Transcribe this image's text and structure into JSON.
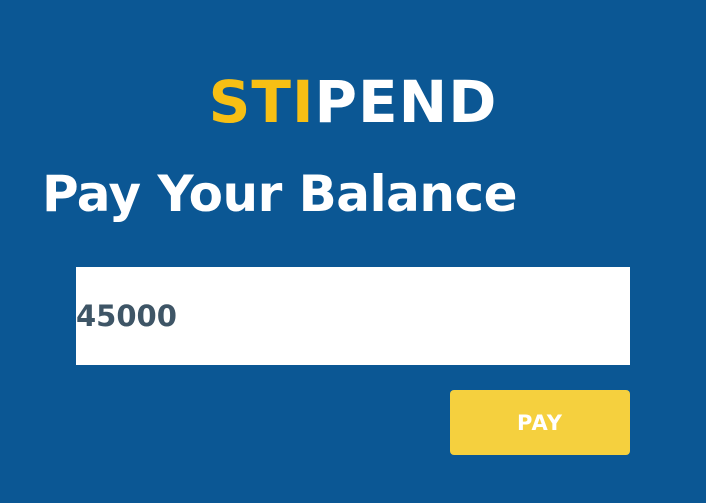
{
  "brand": {
    "accent_text": "STI",
    "rest_text": "PEND",
    "accent_color": "#f7bf14"
  },
  "page": {
    "heading": "Pay Your Balance",
    "background_color": "#0b5794"
  },
  "form": {
    "amount_value": "45000",
    "pay_label": "PAY",
    "pay_color": "#f5d03e"
  }
}
